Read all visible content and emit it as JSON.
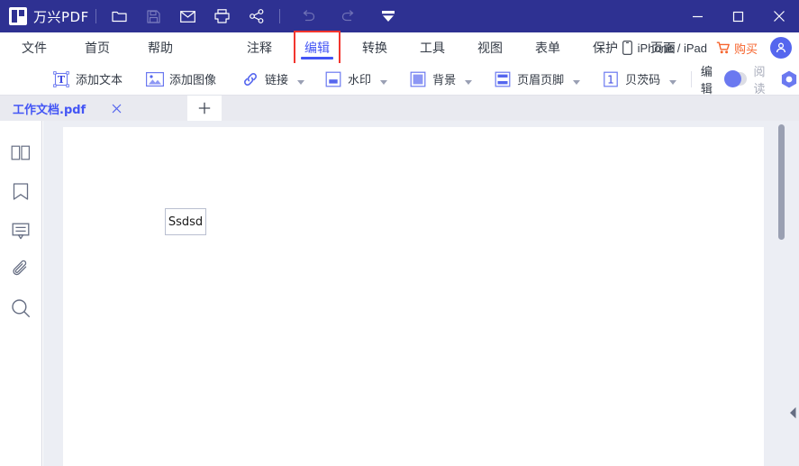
{
  "titlebar": {
    "brand": "万兴PDF",
    "icons": [
      {
        "name": "open-folder-icon",
        "label": "打开"
      },
      {
        "name": "save-icon",
        "label": "保存"
      },
      {
        "name": "email-icon",
        "label": "邮件"
      },
      {
        "name": "print-icon",
        "label": "打印"
      },
      {
        "name": "share-icon",
        "label": "分享"
      },
      {
        "name": "undo-icon",
        "label": "撤销"
      },
      {
        "name": "redo-icon",
        "label": "重做"
      },
      {
        "name": "customize-toolbar-icon",
        "label": "自定义"
      }
    ],
    "window": {
      "minimize": "—",
      "maximize": "□",
      "close": "✕"
    }
  },
  "menubar": {
    "left_items": [
      {
        "label": "文件",
        "active": false
      },
      {
        "label": "首页",
        "active": false
      },
      {
        "label": "帮助",
        "active": false
      }
    ],
    "right_items": [
      {
        "label": "注释",
        "active": false,
        "boxed": false
      },
      {
        "label": "编辑",
        "active": true,
        "boxed": true
      },
      {
        "label": "转换",
        "active": false,
        "boxed": false
      },
      {
        "label": "工具",
        "active": false,
        "boxed": false
      },
      {
        "label": "视图",
        "active": false,
        "boxed": false
      },
      {
        "label": "表单",
        "active": false,
        "boxed": false
      },
      {
        "label": "保护",
        "active": false,
        "boxed": false
      },
      {
        "label": "页面",
        "active": false,
        "boxed": false
      }
    ],
    "mobile_label": "iPhone / iPad",
    "buy_label": "购买",
    "highlight_color": "#f2352e",
    "accent_color": "#4355f5",
    "buy_color": "#f6642d"
  },
  "toolbar": {
    "items": [
      {
        "label": "添加文本",
        "icon": "add-text-icon",
        "caret": false
      },
      {
        "label": "添加图像",
        "icon": "add-image-icon",
        "caret": false
      },
      {
        "label": "链接",
        "icon": "link-icon",
        "caret": true
      },
      {
        "label": "水印",
        "icon": "watermark-icon",
        "caret": true
      },
      {
        "label": "背景",
        "icon": "background-icon",
        "caret": true
      },
      {
        "label": "页眉页脚",
        "icon": "header-footer-icon",
        "caret": true
      },
      {
        "label": "贝茨码",
        "icon": "bates-numbering-icon",
        "caret": true
      }
    ],
    "mode_edit_label": "编辑",
    "mode_read_label": "阅读",
    "mode_toggle_state": "edit",
    "settings_icon": "hex-settings-icon"
  },
  "tabbar": {
    "tabs": [
      {
        "title": "工作文档.pdf",
        "active": true,
        "close": "✕"
      }
    ],
    "add_tab": "+"
  },
  "sidebar": {
    "items": [
      {
        "name": "thumbnails-icon",
        "label": "缩略图"
      },
      {
        "name": "bookmark-icon",
        "label": "书签"
      },
      {
        "name": "comment-icon",
        "label": "注释"
      },
      {
        "name": "attachment-icon",
        "label": "附件"
      },
      {
        "name": "search-icon",
        "label": "搜索"
      }
    ],
    "expander": "▶"
  },
  "document": {
    "page_textbox_value": "Ssdsd",
    "right_collapse": "◀"
  }
}
